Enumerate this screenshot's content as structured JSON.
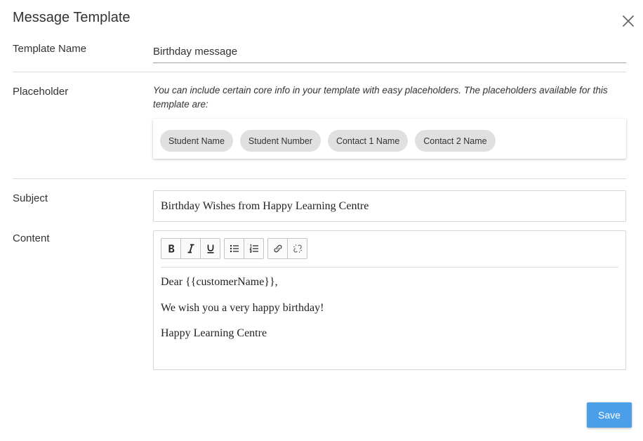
{
  "dialog": {
    "title": "Message Template"
  },
  "template_name": {
    "label": "Template Name",
    "value": "Birthday message"
  },
  "placeholder": {
    "label": "Placeholder",
    "description": "You can include certain core info in your template with easy placeholders. The placeholders available for this template are:",
    "chips": [
      "Student Name",
      "Student Number",
      "Contact 1 Name",
      "Contact 2 Name"
    ]
  },
  "subject": {
    "label": "Subject",
    "value": "Birthday Wishes from Happy Learning Centre"
  },
  "content": {
    "label": "Content",
    "toolbar": [
      "bold-icon",
      "italic-icon",
      "underline-icon",
      "bullet-list-icon",
      "numbered-list-icon",
      "link-icon",
      "unlink-icon"
    ],
    "lines": [
      "Dear {{customerName}},",
      "We wish you a very happy birthday!",
      "Happy Learning Centre"
    ]
  },
  "actions": {
    "save_label": "Save"
  },
  "colors": {
    "primary": "#4a9fe8",
    "chip_bg": "#e0e0e0"
  }
}
